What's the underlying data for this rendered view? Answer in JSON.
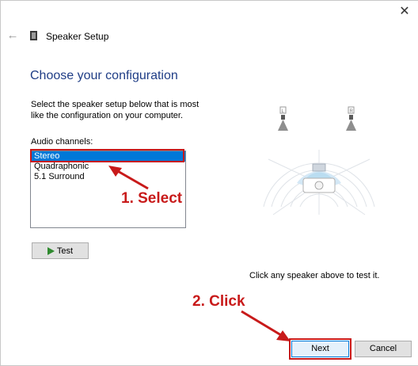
{
  "window": {
    "title": "Speaker Setup",
    "close_glyph": "✕",
    "back_glyph": "←"
  },
  "page": {
    "heading": "Choose your configuration",
    "description": "Select the speaker setup below that is most like the configuration on your computer.",
    "channels_label": "Audio channels:",
    "channels": [
      "Stereo",
      "Quadraphonic",
      "5.1 Surround"
    ],
    "selected_index": 0,
    "test_label": "Test",
    "hint": "Click any speaker above to test it."
  },
  "diagram": {
    "left_speaker_label": "L",
    "right_speaker_label": "R"
  },
  "annotations": {
    "step1": "1. Select",
    "step2": "2. Click"
  },
  "footer": {
    "next_label": "Next",
    "cancel_label": "Cancel"
  },
  "colors": {
    "heading": "#1f3d86",
    "selection": "#0078d7",
    "annotation": "#c81a1a",
    "test_arrow": "#2f8a2f"
  },
  "icons": {
    "back": "back-arrow-icon",
    "app": "speaker-icon",
    "close": "close-icon",
    "test": "play-icon"
  }
}
